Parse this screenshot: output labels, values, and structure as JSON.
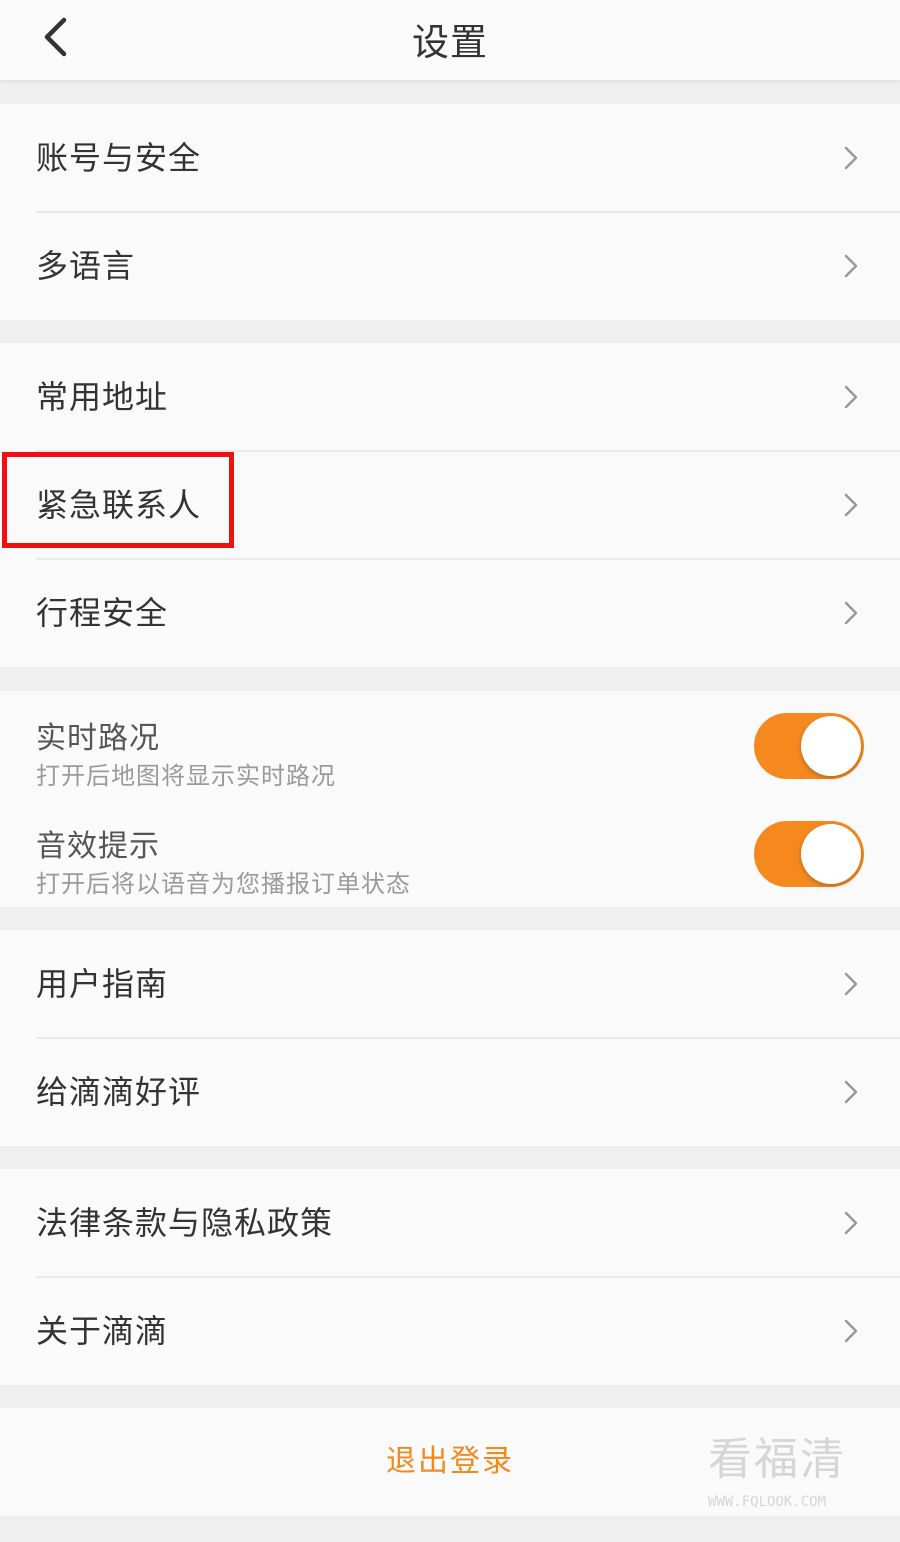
{
  "header": {
    "title": "设置",
    "back_icon": "chevron-left-icon"
  },
  "groups": {
    "account": {
      "items": [
        {
          "label": "账号与安全"
        },
        {
          "label": "多语言"
        }
      ]
    },
    "safety": {
      "items": [
        {
          "label": "常用地址"
        },
        {
          "label": "紧急联系人"
        },
        {
          "label": "行程安全"
        }
      ]
    },
    "toggles": {
      "items": [
        {
          "title": "实时路况",
          "subtitle": "打开后地图将显示实时路况",
          "enabled": true
        },
        {
          "title": "音效提示",
          "subtitle": "打开后将以语音为您播报订单状态",
          "enabled": true
        }
      ]
    },
    "help": {
      "items": [
        {
          "label": "用户指南"
        },
        {
          "label": "给滴滴好评"
        }
      ]
    },
    "legal": {
      "items": [
        {
          "label": "法律条款与隐私政策"
        },
        {
          "label": "关于滴滴"
        }
      ]
    }
  },
  "logout": {
    "label": "退出登录"
  },
  "colors": {
    "accent": "#f5891e",
    "logout_text": "#f08a1f",
    "highlight": "#ee1111",
    "background": "#efefef",
    "row_background": "#fafafa"
  },
  "watermark": {
    "main": "看福清",
    "url": "WWW.FQLOOK.COM"
  }
}
